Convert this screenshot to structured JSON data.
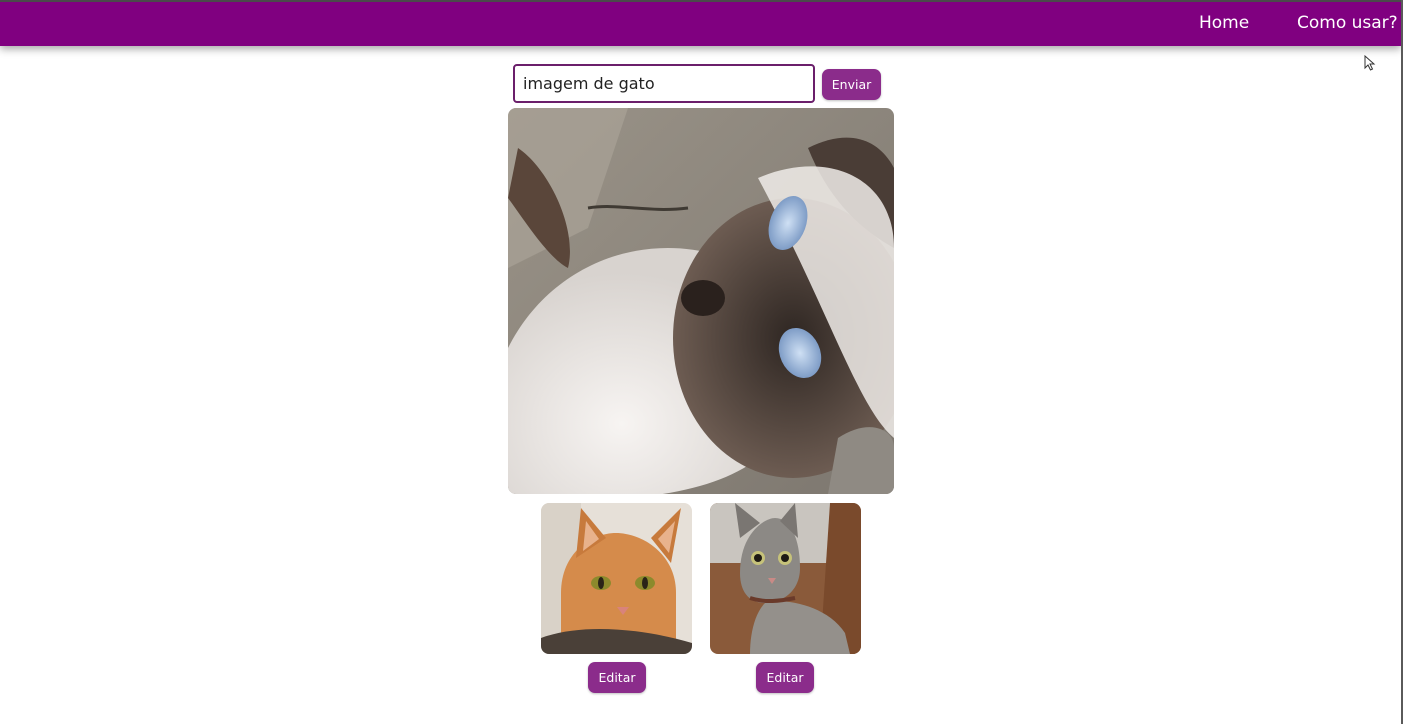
{
  "nav": {
    "home_label": "Home",
    "help_label": "Como usar?"
  },
  "search": {
    "value": "imagem de gato",
    "submit_label": "Enviar"
  },
  "main_image": {
    "subject": "siamese cat close-up"
  },
  "thumbnails": [
    {
      "subject": "orange tabby cat",
      "edit_label": "Editar"
    },
    {
      "subject": "gray tabby kitten",
      "edit_label": "Editar"
    }
  ],
  "colors": {
    "navbar": "#800080",
    "button": "#8b2c8b",
    "input_border": "#6b1f6b"
  },
  "icons": {
    "cursor": "mouse-pointer-icon"
  }
}
